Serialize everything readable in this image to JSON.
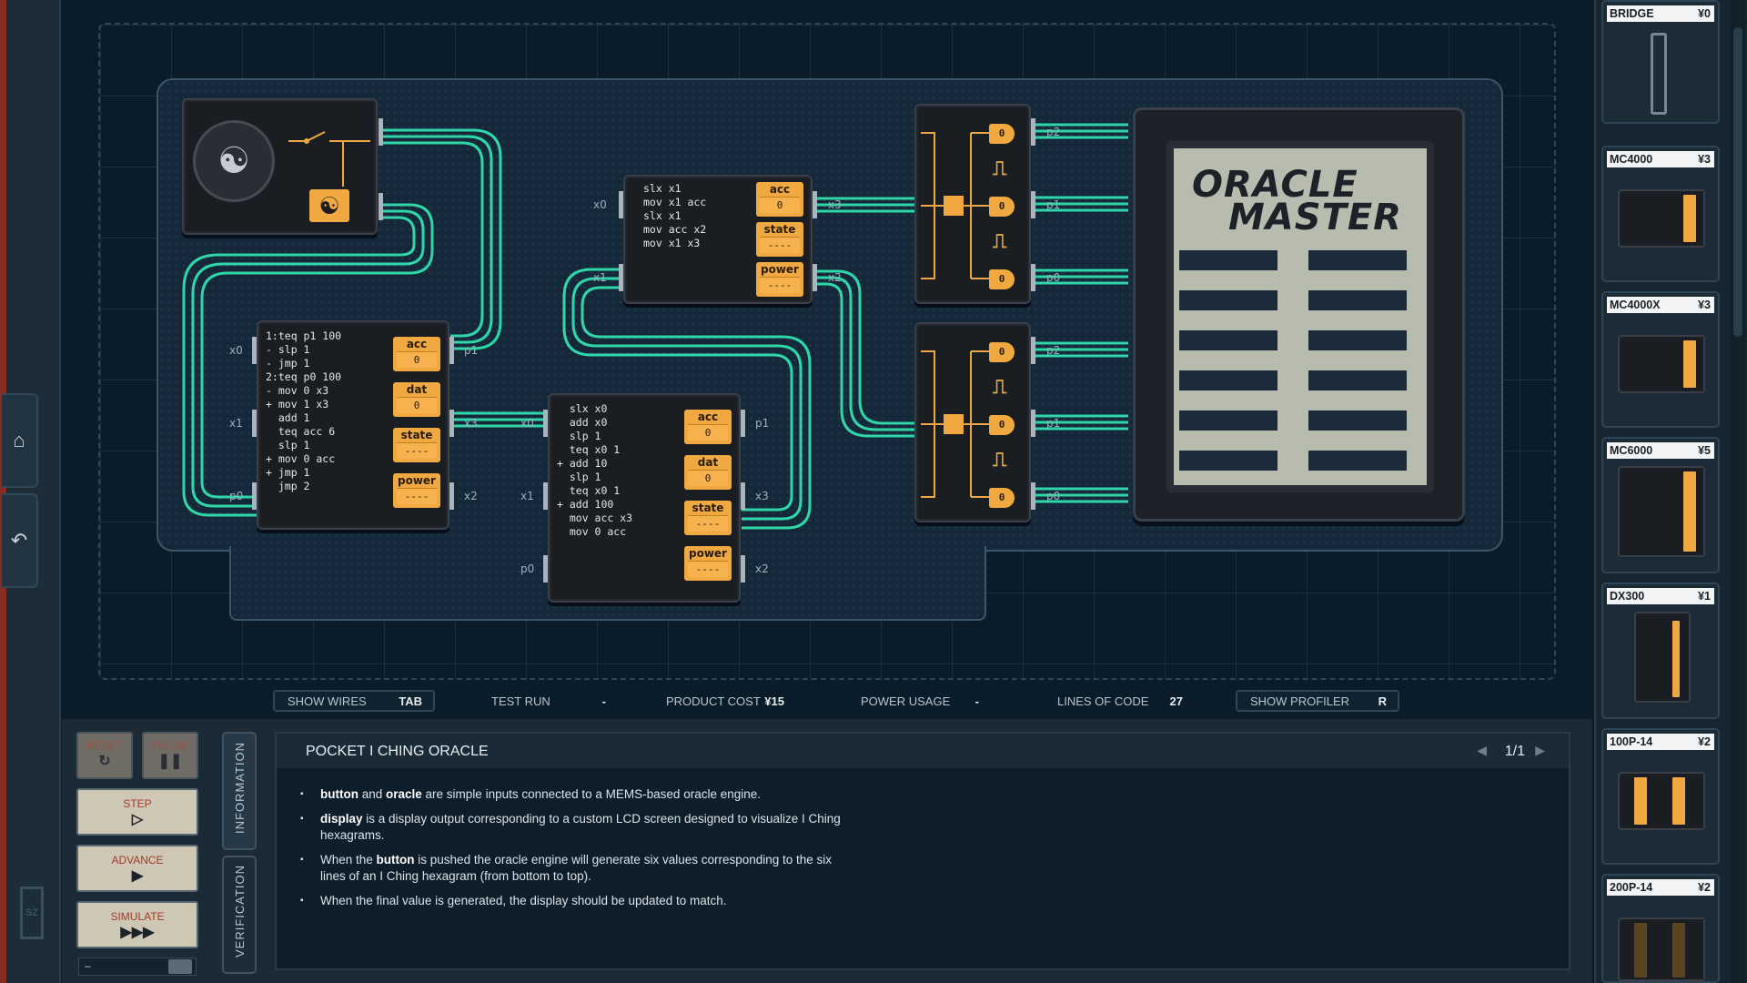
{
  "left_rail": {
    "home_icon": "home-icon",
    "undo_icon": "undo-icon",
    "logo_text": "SZ"
  },
  "chips": {
    "mc_left": {
      "code": "1:teq p1 100\n- slp 1\n- jmp 1\n2:teq p0 100\n- mov 0 x3\n+ mov 1 x3\n  add 1\n  teq acc 6\n  slp 1\n+ mov 0 acc\n+ jmp 1\n  jmp 2",
      "regs": [
        {
          "label": "acc",
          "value": "0"
        },
        {
          "label": "dat",
          "value": "0"
        },
        {
          "label": "state",
          "value": "----"
        },
        {
          "label": "power",
          "value": "----"
        }
      ],
      "pins_left": [
        "x0",
        "x1",
        "p0"
      ],
      "pins_right": [
        "p1",
        "x3",
        "x2"
      ]
    },
    "mc_mid": {
      "code": "  slx x0\n  add x0\n  slp 1\n  teq x0 1\n+ add 10\n  slp 1\n  teq x0 1\n+ add 100\n  mov acc x3\n  mov 0 acc",
      "regs": [
        {
          "label": "acc",
          "value": "0"
        },
        {
          "label": "dat",
          "value": "0"
        },
        {
          "label": "state",
          "value": "----"
        },
        {
          "label": "power",
          "value": "----"
        }
      ],
      "pins_left": [
        "x0",
        "x1",
        "p0"
      ],
      "pins_right": [
        "p1",
        "x3",
        "x2"
      ]
    },
    "mc_top": {
      "code": "slx x1\nmov x1 acc\nslx x1\nmov acc x2\nmov x1 x3",
      "regs": [
        {
          "label": "acc",
          "value": "0"
        },
        {
          "label": "state",
          "value": "----"
        },
        {
          "label": "power",
          "value": "----"
        }
      ],
      "pins_left": [
        "x0",
        "x1"
      ],
      "pins_right": [
        "x3",
        "x2"
      ]
    },
    "dx_top": {
      "gates": [
        "0",
        "0",
        "0"
      ],
      "pins_right": [
        "p2",
        "p1",
        "p0"
      ]
    },
    "dx_bottom": {
      "gates": [
        "0",
        "0",
        "0"
      ],
      "pins_right": [
        "p2",
        "p1",
        "p0"
      ]
    },
    "lcd_title_line1": "ORACLE",
    "lcd_title_line2": "MASTER"
  },
  "toolbar": {
    "show_wires": {
      "label": "SHOW WIRES",
      "value": "TAB"
    },
    "test_run": {
      "label": "TEST RUN",
      "value": "-"
    },
    "product_cost": {
      "label": "PRODUCT COST",
      "value": "¥15"
    },
    "power_usage": {
      "label": "POWER USAGE",
      "value": "-"
    },
    "lines_of_code": {
      "label": "LINES OF CODE",
      "value": "27"
    },
    "show_profiler": {
      "label": "SHOW PROFILER",
      "value": "R"
    }
  },
  "controls": {
    "reset": "RESET",
    "pause": "PAUSE",
    "step": "STEP",
    "advance": "ADVANCE",
    "simulate": "SIMULATE",
    "slider_min": "–"
  },
  "tabs": {
    "information": "INFORMATION",
    "verification": "VERIFICATION"
  },
  "info": {
    "title": "POCKET I CHING ORACLE",
    "page": "1/1",
    "bullets": [
      {
        "b1": "button",
        "t1": " and ",
        "b2": "oracle",
        "t2": " are simple inputs connected to a MEMS-based oracle engine."
      },
      {
        "b1": "display",
        "t1": " is a display output corresponding to a custom LCD screen designed to visualize I Ching hexagrams.",
        "b2": "",
        "t2": ""
      },
      {
        "b1": "",
        "t1": "When the ",
        "b2": "button",
        "t2": " is pushed the oracle engine will generate six values corresponding to the six lines of an I Ching hexagram (from bottom to top)."
      },
      {
        "b1": "",
        "t1": "When the final value is generated, the display should be updated to match.",
        "b2": "",
        "t2": ""
      }
    ]
  },
  "parts": [
    {
      "name": "BRIDGE",
      "cost": "¥0"
    },
    {
      "name": "MC4000",
      "cost": "¥3"
    },
    {
      "name": "MC4000X",
      "cost": "¥3"
    },
    {
      "name": "MC6000",
      "cost": "¥5"
    },
    {
      "name": "DX300",
      "cost": "¥1"
    },
    {
      "name": "100P-14",
      "cost": "¥2"
    },
    {
      "name": "200P-14",
      "cost": "¥2"
    }
  ],
  "colors": {
    "accent": "#f0a940",
    "wire": "#2fd6a8",
    "board": "#14283a",
    "lcd": "#b8bcae"
  }
}
